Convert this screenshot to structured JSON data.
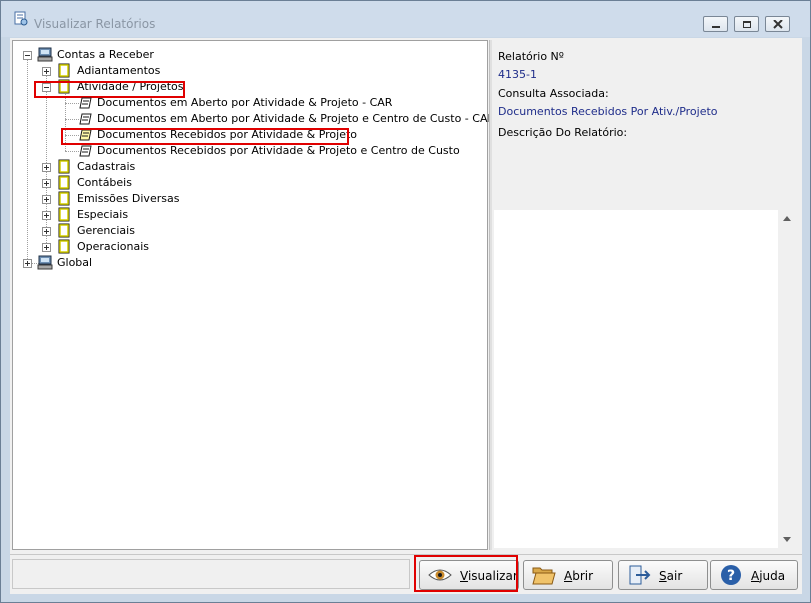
{
  "window": {
    "title": "Visualizar Relatórios",
    "controls": [
      "minimize",
      "maximize",
      "close"
    ]
  },
  "tree": {
    "root1": "Contas a Receber",
    "items": [
      {
        "label": "Adiantamentos",
        "expanded": false
      },
      {
        "label": "Atividade / Projetos",
        "expanded": true,
        "highlighted": true
      },
      {
        "label": "Cadastrais",
        "expanded": false
      },
      {
        "label": "Contábeis",
        "expanded": false
      },
      {
        "label": "Emissões Diversas",
        "expanded": false
      },
      {
        "label": "Especiais",
        "expanded": false
      },
      {
        "label": "Gerenciais",
        "expanded": false
      },
      {
        "label": "Operacionais",
        "expanded": false
      }
    ],
    "reports": [
      {
        "label": "Documentos em Aberto por Atividade & Projeto - CAR"
      },
      {
        "label": "Documentos em Aberto por Atividade & Projeto e Centro de Custo - CAR"
      },
      {
        "label": "Documentos Recebidos por Atividade & Projeto",
        "selected": true
      },
      {
        "label": "Documentos Recebidos por Atividade & Projeto e Centro de Custo"
      }
    ],
    "root2": "Global"
  },
  "info": {
    "report_no_label": "Relatório Nº",
    "report_no_value": "4135-1",
    "query_label": "Consulta Associada:",
    "query_value": "Documentos Recebidos Por Ativ./Projeto",
    "description_label": "Descrição Do Relatório:"
  },
  "buttons": {
    "view": "Visualizar",
    "open": "Abrir",
    "exit": "Sair",
    "help": "Ajuda"
  },
  "colors": {
    "highlight_box": "#e00000",
    "info_value": "#1f2d8a",
    "folder_outline": "#c8c400"
  }
}
